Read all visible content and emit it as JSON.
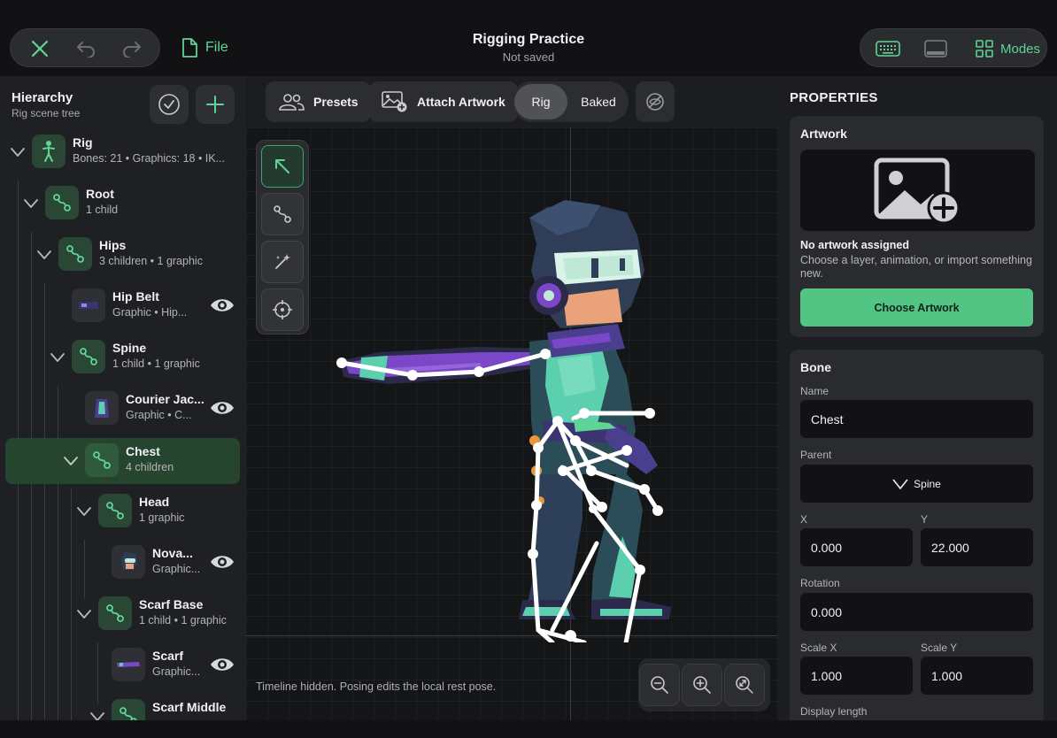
{
  "header": {
    "file_label": "File",
    "title": "Rigging Practice",
    "subtitle": "Not saved",
    "modes_label": "Modes"
  },
  "hierarchy": {
    "title": "Hierarchy",
    "subtitle": "Rig scene tree",
    "rows": [
      {
        "name": "Rig",
        "meta": "Bones: 21  •  Graphics: 18  •  IK..."
      },
      {
        "name": "Root",
        "meta": "1 child"
      },
      {
        "name": "Hips",
        "meta": "3 children  •  1 graphic"
      },
      {
        "name": "Hip Belt",
        "meta": "Graphic  •  Hip..."
      },
      {
        "name": "Spine",
        "meta": "1 child  •  1 graphic"
      },
      {
        "name": "Courier Jac...",
        "meta": "Graphic  •  C..."
      },
      {
        "name": "Chest",
        "meta": "4 children"
      },
      {
        "name": "Head",
        "meta": "1 graphic"
      },
      {
        "name": "Nova...",
        "meta": "Graphic..."
      },
      {
        "name": "Scarf Base",
        "meta": "1 child  •  1 graphic"
      },
      {
        "name": "Scarf",
        "meta": "Graphic..."
      },
      {
        "name": "Scarf Middle",
        "meta": ""
      }
    ]
  },
  "canvas": {
    "presets_label": "Presets",
    "attach_label": "Attach Artwork",
    "mode_rig": "Rig",
    "mode_baked": "Baked",
    "hint": "Timeline hidden. Posing edits the local rest pose."
  },
  "properties": {
    "title": "PROPERTIES",
    "artwork": {
      "title": "Artwork",
      "none_title": "No artwork assigned",
      "none_body": "Choose a layer, animation, or import something new.",
      "button": "Choose Artwork"
    },
    "bone": {
      "title": "Bone",
      "name_label": "Name",
      "name_value": "Chest",
      "parent_label": "Parent",
      "parent_value": "Spine",
      "x_label": "X",
      "x_value": "0.000",
      "y_label": "Y",
      "y_value": "22.000",
      "rotation_label": "Rotation",
      "rotation_value": "0.000",
      "scalex_label": "Scale X",
      "scalex_value": "1.000",
      "scaley_label": "Scale Y",
      "scaley_value": "1.000",
      "display_length_label": "Display length"
    }
  },
  "colors": {
    "accent": "#5fd497",
    "selected_row": "#26452f",
    "button_green": "#52c585",
    "character_purple": "#7b46c7",
    "character_teal": "#5ccfae"
  }
}
